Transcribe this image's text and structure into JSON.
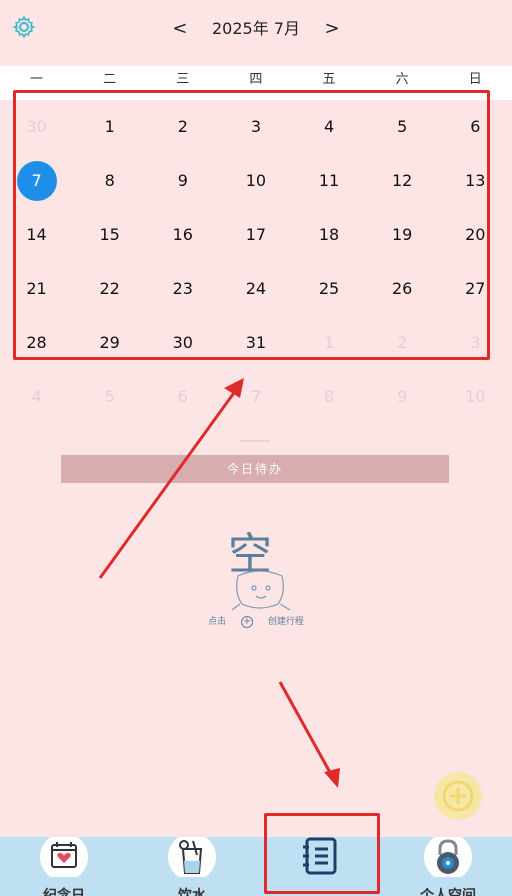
{
  "header": {
    "month_title": "2025年 7月",
    "prev_label": "<",
    "next_label": ">",
    "settings_icon": "gear-icon"
  },
  "weekdays": [
    "一",
    "二",
    "三",
    "四",
    "五",
    "六",
    "日"
  ],
  "calendar": {
    "weeks": [
      [
        {
          "d": "30",
          "faded": true
        },
        {
          "d": "1"
        },
        {
          "d": "2"
        },
        {
          "d": "3"
        },
        {
          "d": "4"
        },
        {
          "d": "5"
        },
        {
          "d": "6"
        }
      ],
      [
        {
          "d": "7",
          "today": true
        },
        {
          "d": "8"
        },
        {
          "d": "9"
        },
        {
          "d": "10"
        },
        {
          "d": "11"
        },
        {
          "d": "12"
        },
        {
          "d": "13"
        }
      ],
      [
        {
          "d": "14"
        },
        {
          "d": "15"
        },
        {
          "d": "16"
        },
        {
          "d": "17"
        },
        {
          "d": "18"
        },
        {
          "d": "19"
        },
        {
          "d": "20"
        }
      ],
      [
        {
          "d": "21"
        },
        {
          "d": "22"
        },
        {
          "d": "23"
        },
        {
          "d": "24"
        },
        {
          "d": "25"
        },
        {
          "d": "26"
        },
        {
          "d": "27"
        }
      ],
      [
        {
          "d": "28"
        },
        {
          "d": "29"
        },
        {
          "d": "30"
        },
        {
          "d": "31"
        },
        {
          "d": "1",
          "faded": true
        },
        {
          "d": "2",
          "faded": true
        },
        {
          "d": "3",
          "faded": true
        }
      ],
      [
        {
          "d": "4",
          "faded": true
        },
        {
          "d": "5",
          "faded": true
        },
        {
          "d": "6",
          "faded": true
        },
        {
          "d": "7",
          "faded": true
        },
        {
          "d": "8",
          "faded": true
        },
        {
          "d": "9",
          "faded": true
        },
        {
          "d": "10",
          "faded": true
        }
      ]
    ]
  },
  "todo": {
    "title": "今日待办",
    "empty_word": "空",
    "hint_prefix": "点击",
    "hint_plus": "+",
    "hint_suffix": "创建行程"
  },
  "tabbar": {
    "tabs": [
      {
        "icon": "calendar-heart-icon",
        "label": "纪念日"
      },
      {
        "icon": "drink-cup-icon",
        "label": "饮水"
      },
      {
        "icon": "notebook-list-icon",
        "label": ""
      },
      {
        "icon": "lock-icon",
        "label": "个人空间"
      }
    ]
  },
  "colors": {
    "background": "#fde5e6",
    "today": "#1e8fe8",
    "annotation": "#e02a2a",
    "tabbar": "#bfdff3",
    "todo_bar": "#d8adb0"
  }
}
